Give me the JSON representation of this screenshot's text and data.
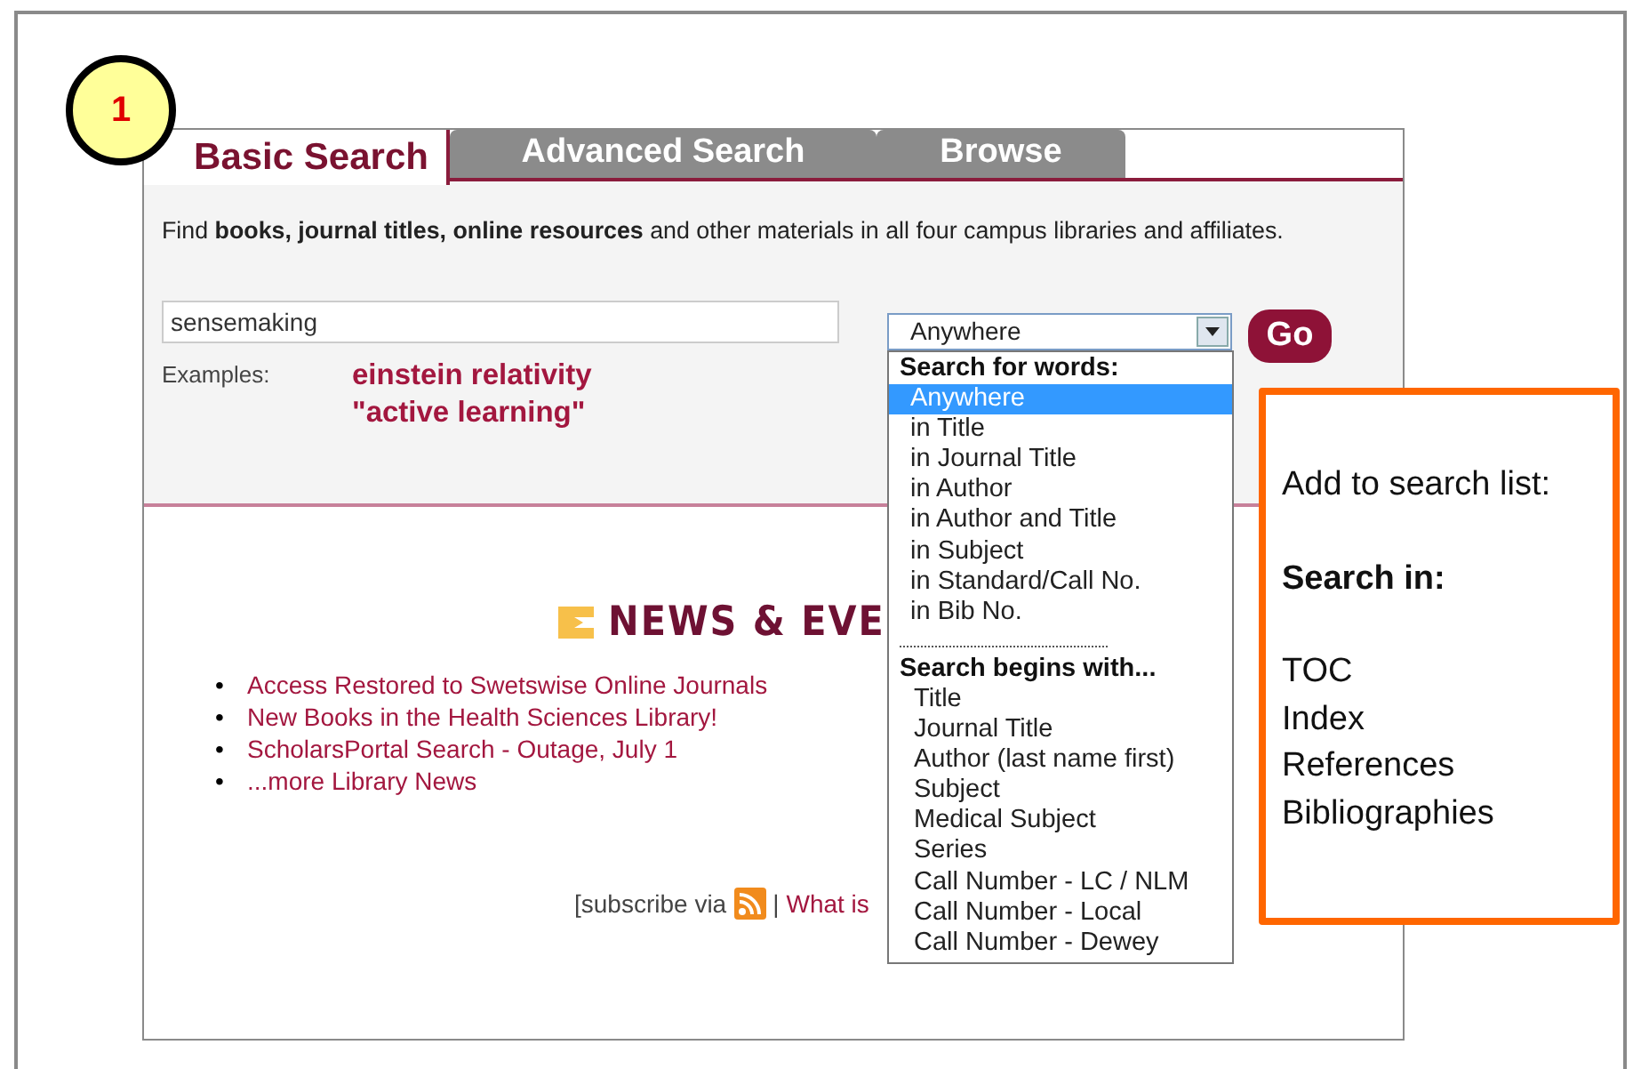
{
  "step_badge": "1",
  "tabs": [
    {
      "label": "Basic Search",
      "selected": true
    },
    {
      "label": "Advanced Search",
      "selected": false
    },
    {
      "label": "Browse",
      "selected": false
    }
  ],
  "intro": "Find **books, journal titles, online resources** and other materials in all four campus libraries and affiliates.",
  "search": {
    "value": "sensemaking",
    "scope": "Anywhere",
    "go_button": "Go"
  },
  "examples": {
    "label": "Examples:",
    "items": [
      "einstein relativity",
      "\"active learning\""
    ]
  },
  "scope_menu": [
    {
      "kind": "header",
      "label": "Search for words:"
    },
    {
      "kind": "option",
      "label": "Anywhere",
      "selected": true
    },
    {
      "kind": "option",
      "label": "in Title",
      "selected": false
    },
    {
      "kind": "option",
      "label": "in Journal Title",
      "selected": false
    },
    {
      "kind": "option",
      "label": "in Author",
      "selected": false
    },
    {
      "kind": "option",
      "label": "in Author and Title",
      "selected": false
    },
    {
      "kind": "option",
      "label": "in Subject",
      "selected": false
    },
    {
      "kind": "option",
      "label": "in Standard/Call No.",
      "selected": false
    },
    {
      "kind": "option",
      "label": "in Bib No.",
      "selected": false
    },
    {
      "kind": "separator"
    },
    {
      "kind": "header",
      "label": "Search begins with..."
    },
    {
      "kind": "option",
      "label": "Title",
      "selected": false
    },
    {
      "kind": "option",
      "label": "Journal Title",
      "selected": false
    },
    {
      "kind": "option",
      "label": "Author (last name first)",
      "selected": false
    },
    {
      "kind": "option",
      "label": "Subject",
      "selected": false
    },
    {
      "kind": "option",
      "label": "Medical Subject",
      "selected": false
    },
    {
      "kind": "option",
      "label": "Series",
      "selected": false
    },
    {
      "kind": "option",
      "label": "Call Number - LC / NLM",
      "selected": false
    },
    {
      "kind": "option",
      "label": "Call Number - Local",
      "selected": false
    },
    {
      "kind": "option",
      "label": "Call Number - Dewey",
      "selected": false
    }
  ],
  "news": {
    "heading": "NEWS & EVE",
    "items": [
      {
        "bullet": "•",
        "label": "Access Restored to Swetswise Online Journals"
      },
      {
        "bullet": "•",
        "label": "New Books in the Health Sciences Library!"
      },
      {
        "bullet": "•",
        "label": "ScholarsPortal Search - Outage, July 1"
      },
      {
        "bullet": "•",
        "label": "...more Library News"
      }
    ],
    "subscribe_text": "[subscribe via",
    "divider": "|",
    "link": "What is"
  },
  "callout": {
    "intro": "Add to search list:",
    "heading": "Search in:",
    "items": [
      "TOC",
      "Index",
      "References",
      "Bibliographies"
    ]
  }
}
